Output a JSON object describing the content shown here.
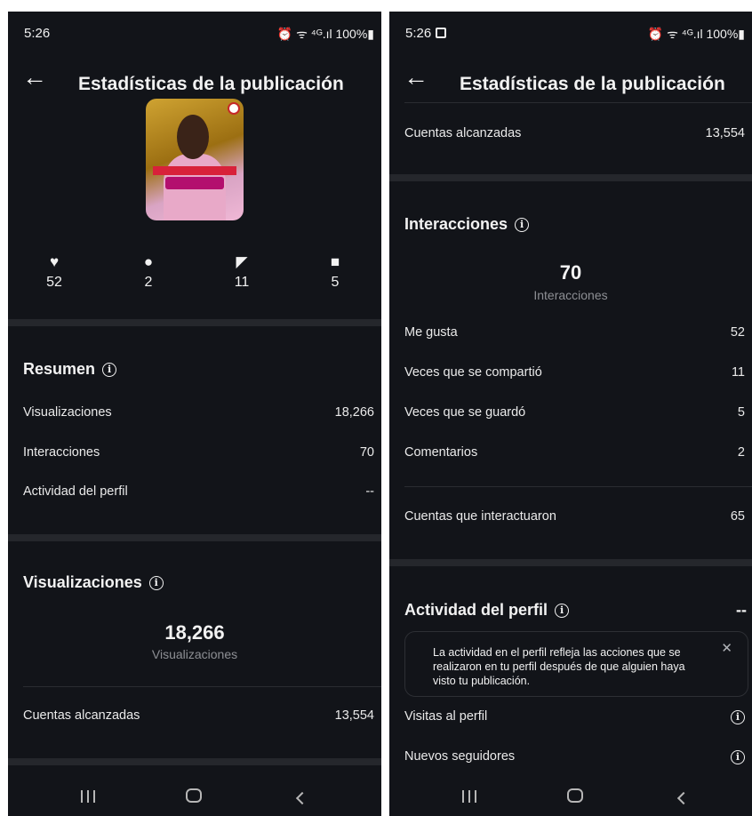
{
  "status_bar": {
    "time": "5:26",
    "icons": "⏰ ᯤ ⁴ᴳ.ıl 100%▮",
    "left_time": "5:26",
    "right_time": "5:26"
  },
  "header": {
    "title": "Estadísticas de la publicación"
  },
  "post": {
    "likes": "52",
    "comments": "2",
    "shares": "11",
    "saves": "5"
  },
  "summary": {
    "title": "Resumen",
    "rows": [
      {
        "label": "Visualizaciones",
        "value": "18,266"
      },
      {
        "label": "Interacciones",
        "value": "70"
      },
      {
        "label": "Actividad del perfil",
        "value": "--"
      }
    ]
  },
  "views": {
    "title": "Visualizaciones",
    "big_value": "18,266",
    "big_label": "Visualizaciones",
    "reached_label": "Cuentas alcanzadas",
    "reached_value": "13,554"
  },
  "interactions": {
    "title": "Interacciones",
    "big_value": "70",
    "big_label": "Interacciones",
    "rows": [
      {
        "label": "Me gusta",
        "value": "52"
      },
      {
        "label": "Veces que se compartió",
        "value": "11"
      },
      {
        "label": "Veces que se guardó",
        "value": "5"
      },
      {
        "label": "Comentarios",
        "value": "2"
      }
    ],
    "accounts_label": "Cuentas que interactuaron",
    "accounts_value": "65"
  },
  "profile_activity": {
    "title": "Actividad del perfil",
    "value": "--",
    "tip": "La actividad en el perfil refleja las acciones que se realizaron en tu perfil después de que alguien haya visto tu publicación.",
    "rows": [
      {
        "label": "Visitas al perfil"
      },
      {
        "label": "Nuevos seguidores"
      }
    ]
  },
  "icons": {
    "back": "arrow-left",
    "like": "heart",
    "comment": "speech-bubble",
    "share": "paper-plane",
    "save": "bookmark",
    "info": "info-circle",
    "close": "close-x"
  }
}
